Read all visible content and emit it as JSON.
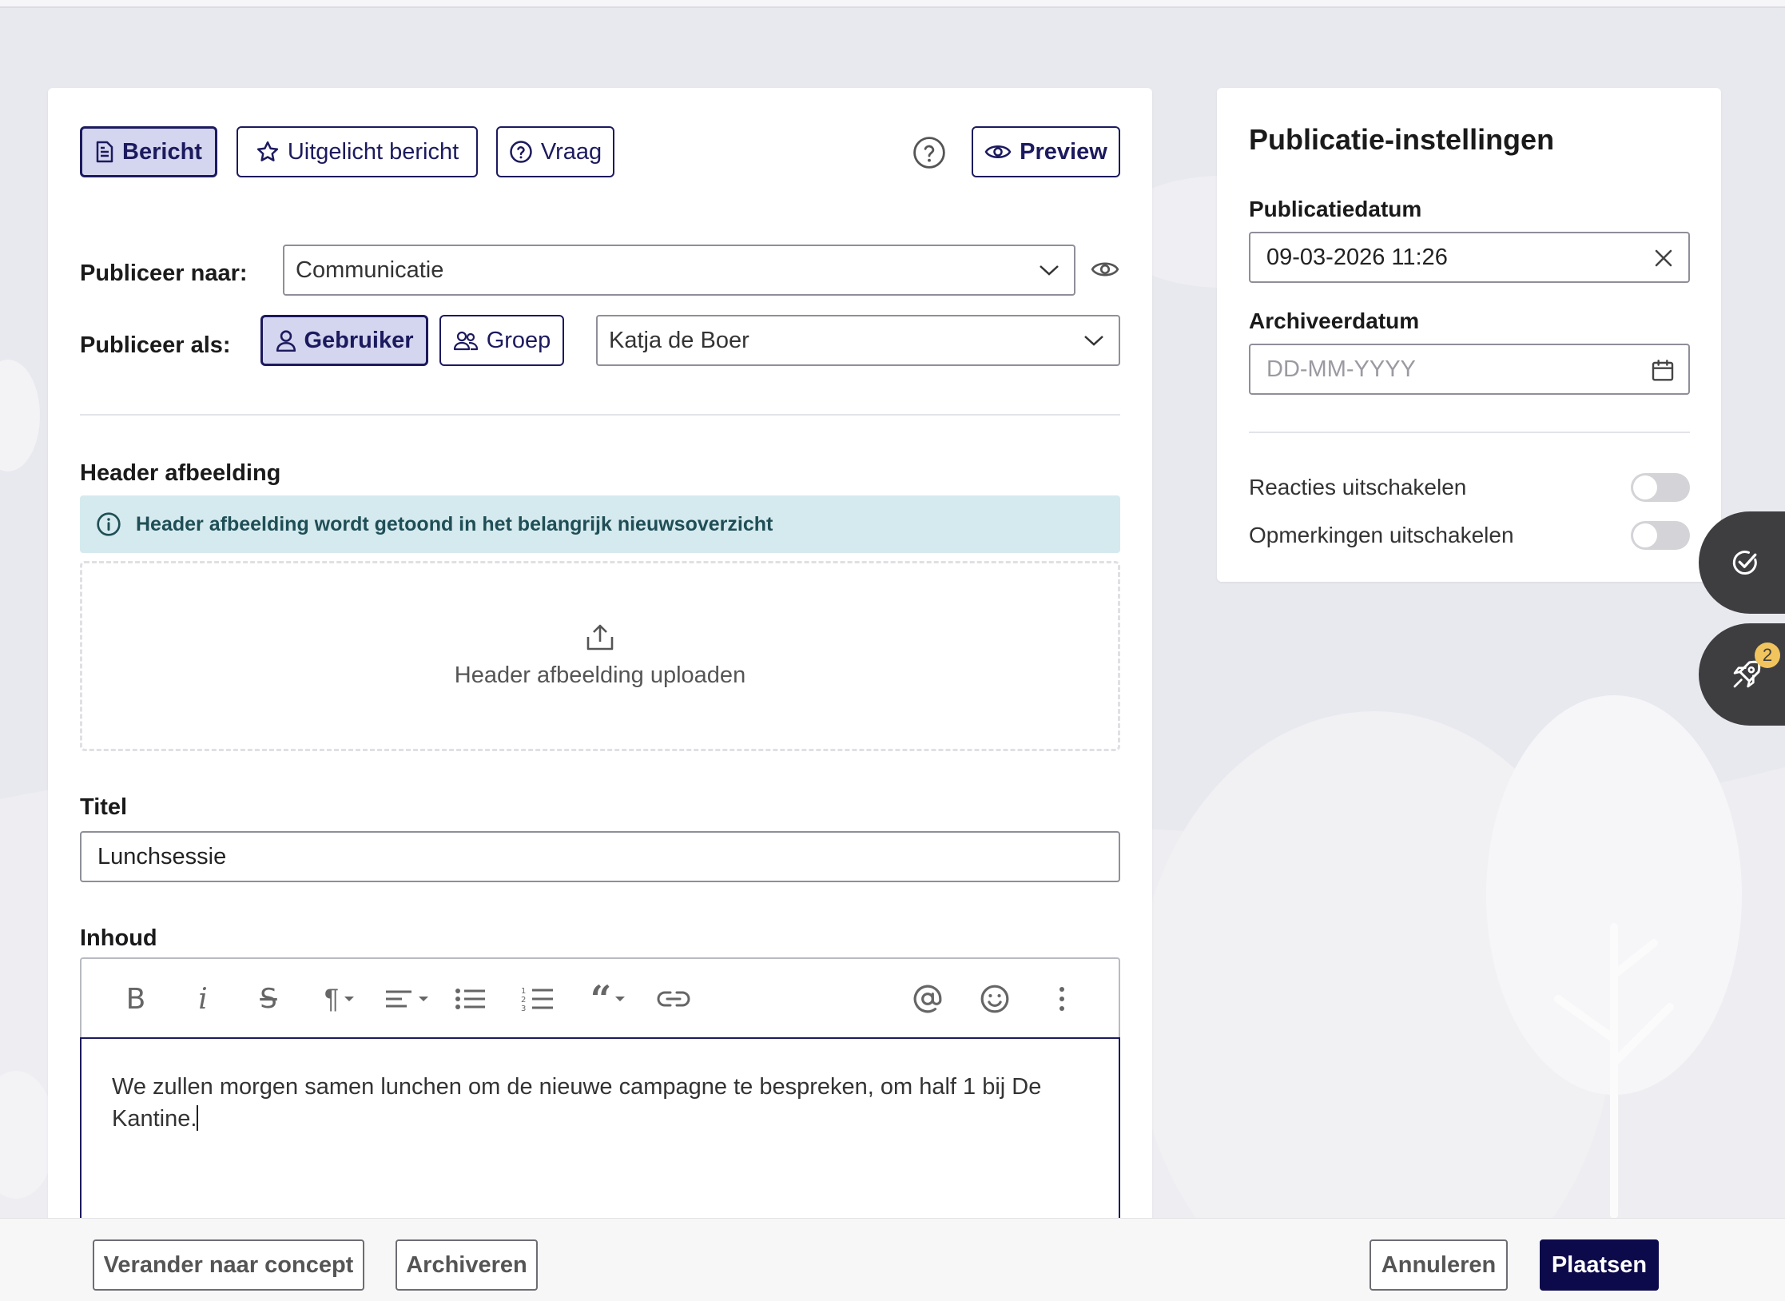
{
  "colors": {
    "brand": "#1c1a5e",
    "brand_active_bg": "#d4d5ee",
    "primary_button": "#0d0a4c",
    "info_bg": "#d5eaee",
    "badge": "#f2c45d"
  },
  "tabs": [
    {
      "label": "Bericht",
      "icon": "document-icon",
      "active": true
    },
    {
      "label": "Uitgelicht bericht",
      "icon": "star-icon",
      "active": false
    },
    {
      "label": "Vraag",
      "icon": "question-circle-icon",
      "active": false
    }
  ],
  "preview_label": "Preview",
  "publish_to": {
    "label": "Publiceer naar:",
    "value": "Communicatie"
  },
  "publish_as": {
    "label": "Publiceer als:",
    "options": [
      {
        "label": "Gebruiker",
        "active": true
      },
      {
        "label": "Groep",
        "active": false
      }
    ],
    "value": "Katja de Boer"
  },
  "header_image": {
    "label": "Header afbeelding",
    "info": "Header afbeelding wordt getoond in het belangrijk nieuwsoverzicht",
    "upload_label": "Header afbeelding uploaden"
  },
  "title_field": {
    "label": "Titel",
    "value": "Lunchsessie"
  },
  "content_field": {
    "label": "Inhoud",
    "text": "We zullen morgen samen lunchen om de nieuwe campagne te bespreken, om half 1 bij De Kantine."
  },
  "publication_settings": {
    "title": "Publicatie-instellingen",
    "publish_date_label": "Publicatiedatum",
    "publish_date_value": "09-03-2026 11:26",
    "archive_date_label": "Archiveerdatum",
    "archive_date_placeholder": "DD-MM-YYYY",
    "toggles": [
      {
        "label": "Reacties uitschakelen",
        "on": false
      },
      {
        "label": "Opmerkingen uitschakelen",
        "on": false
      }
    ]
  },
  "fab_badge": "2",
  "footer": {
    "concept": "Verander naar concept",
    "archive": "Archiveren",
    "cancel": "Annuleren",
    "post": "Plaatsen"
  }
}
